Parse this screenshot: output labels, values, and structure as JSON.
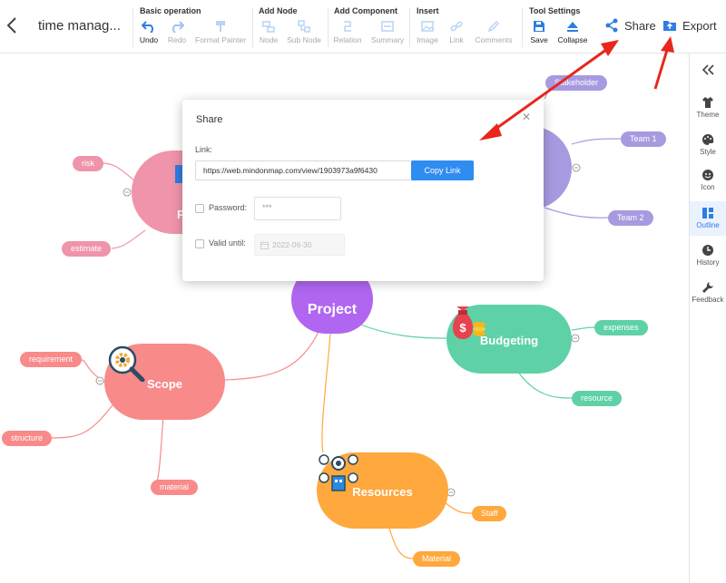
{
  "header": {
    "doc_title": "time manag...",
    "groups": {
      "basic": "Basic operation",
      "add_node": "Add Node",
      "add_component": "Add Component",
      "insert": "Insert",
      "tool_settings": "Tool Settings"
    },
    "tools": {
      "undo": "Undo",
      "redo": "Redo",
      "format_painter": "Format Painter",
      "node": "Node",
      "sub_node": "Sub Node",
      "relation": "Relation",
      "summary": "Summary",
      "image": "Image",
      "link": "Link",
      "comments": "Comments",
      "save": "Save",
      "collapse": "Collapse"
    },
    "share": "Share",
    "export": "Export"
  },
  "sidebar": {
    "items": [
      {
        "label": "Theme",
        "icon": "shirt-icon"
      },
      {
        "label": "Style",
        "icon": "palette-icon"
      },
      {
        "label": "Icon",
        "icon": "smiley-icon"
      },
      {
        "label": "Outline",
        "icon": "outline-icon",
        "active": true
      },
      {
        "label": "History",
        "icon": "clock-icon"
      },
      {
        "label": "Feedback",
        "icon": "wrench-icon"
      }
    ]
  },
  "mindmap": {
    "center": "Project",
    "scope": "Scope",
    "budgeting": "Budgeting",
    "resources": "Resources",
    "planning_partial": "P",
    "leaves": {
      "risk": "risk",
      "estimate": "estimate",
      "stakeholder": "Stakeholder",
      "team1": "Team 1",
      "team2": "Team 2",
      "requirement": "requirement",
      "structure": "structure",
      "material_scope": "material",
      "expenses": "expenses",
      "resource": "resource",
      "staff": "Staff",
      "material_res": "Material"
    }
  },
  "dialog": {
    "title": "Share",
    "link_label": "Link:",
    "link_value": "https://web.mindonmap.com/view/1903973a9f6430",
    "copy_label": "Copy Link",
    "password_label": "Password:",
    "password_value": "***",
    "valid_label": "Valid until:",
    "valid_placeholder": "2022-06-30"
  },
  "colors": {
    "accent": "#2f8cf0",
    "center": "#b066f0",
    "scope": "#f88a8a",
    "budgeting": "#5ed1a6",
    "resources": "#ffa83d",
    "planning": "#ef94aa",
    "stakeholder": "#a89ae0",
    "annotation_arrow": "#e8261c"
  }
}
